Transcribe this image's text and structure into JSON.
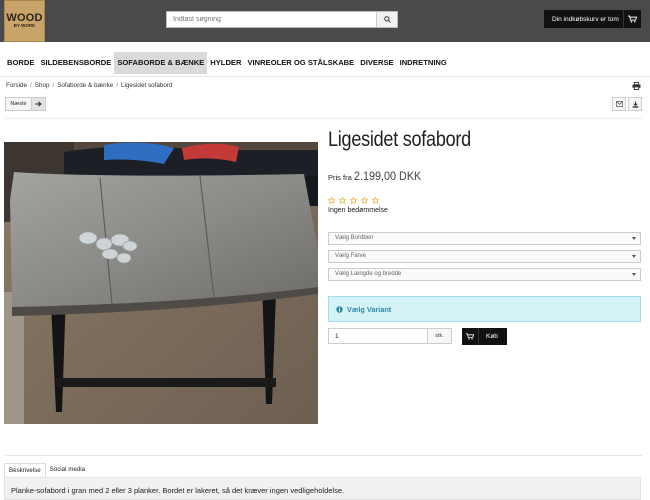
{
  "header": {
    "logo_line1": "WOOD",
    "logo_line2": "BY WORK",
    "search_placeholder": "Indtast søgning",
    "search_icon": "search-icon",
    "cart_label": "Din indkøbskurv er tom",
    "cart_icon": "cart-icon"
  },
  "nav": {
    "items": [
      {
        "label": "BORDE"
      },
      {
        "label": "SILDEBENSBORDE"
      },
      {
        "label": "SOFABORDE & BÆNKE",
        "active": true
      },
      {
        "label": "HYLDER"
      },
      {
        "label": "VINREOLER OG STÅLSKABE"
      },
      {
        "label": "DIVERSE"
      },
      {
        "label": "INDRETNING"
      }
    ]
  },
  "breadcrumb": {
    "items": [
      "Forside",
      "Shop",
      "Sofaborde & bænke",
      "Ligesidet sofabord"
    ],
    "separator": "/"
  },
  "toolbar": {
    "next_label": "Næste",
    "print_icon": "print-icon",
    "email_icon": "envelope-icon",
    "download_icon": "download-icon"
  },
  "product": {
    "title": "Ligesidet sofabord",
    "price_prefix": "Pris fra",
    "price": "2.199,00 DKK",
    "rating_stars": 0,
    "rating_max": 5,
    "no_reviews": "Ingen bedømmelse",
    "selects": [
      {
        "placeholder": "Vælg Bordben"
      },
      {
        "placeholder": "Vælg Farve"
      },
      {
        "placeholder": "Vælg Længde og bredde"
      }
    ],
    "alert": "Vælg Variant",
    "quantity": "1",
    "unit": "stk.",
    "buy_label": "Køb"
  },
  "tabs": {
    "items": [
      {
        "label": "Beskrivelse",
        "active": true
      },
      {
        "label": "Social media"
      }
    ],
    "description": "Planke-sofabord i gran med 2 eller 3 planker. Bordet er lakeret, så det kræver ingen vedligeholdelse."
  },
  "colors": {
    "topbar": "#4a4a4a",
    "logo_bg": "#c8a46a",
    "active_nav": "#dadada",
    "alert_bg": "#d5f2f7",
    "alert_text": "#2d8aa3",
    "buy_bg": "#111111"
  }
}
